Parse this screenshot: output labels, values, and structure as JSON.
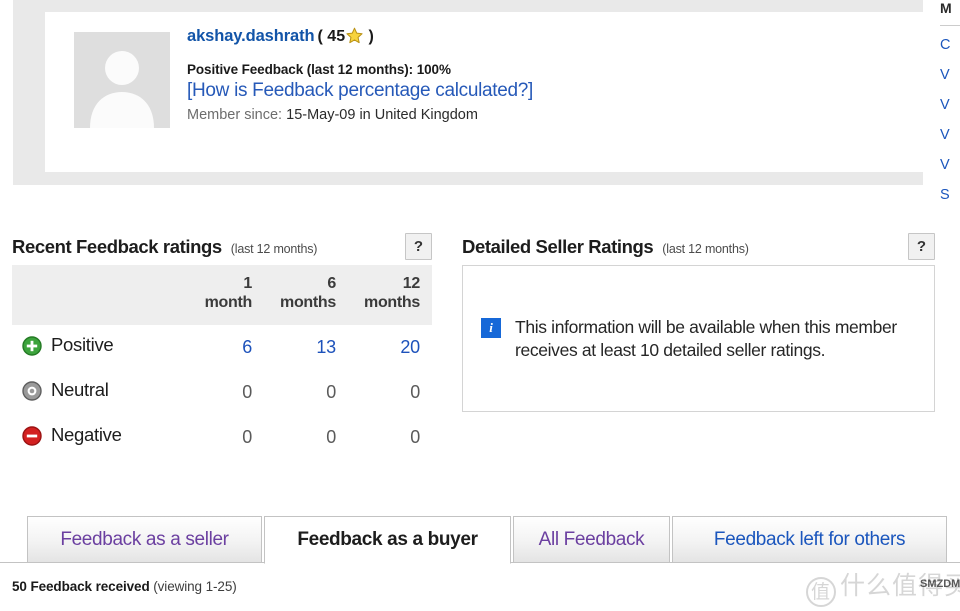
{
  "profile": {
    "username": "akshay.dashrath",
    "score_open": "(",
    "score": "45",
    "score_close": ")",
    "star_icon": "yellow-star-icon",
    "avatar_icon": "default-avatar-icon",
    "positive_feedback": "Positive Feedback (last 12 months): 100%",
    "how_calculated_link": "[How is Feedback percentage calculated?]",
    "member_since_label": "Member since:",
    "member_since_value": "15-May-09 in United Kingdom"
  },
  "recent_feedback": {
    "title": "Recent Feedback ratings",
    "subtitle": "(last 12 months)",
    "help_label": "?",
    "columns": [
      "",
      "1 month",
      "6 months",
      "12 months"
    ],
    "column_lines": [
      [
        "1",
        "month"
      ],
      [
        "6",
        "months"
      ],
      [
        "12",
        "months"
      ]
    ],
    "rows": [
      {
        "label": "Positive",
        "icon": "positive-plus-icon",
        "values": [
          "6",
          "13",
          "20"
        ],
        "linked": true
      },
      {
        "label": "Neutral",
        "icon": "neutral-circle-icon",
        "values": [
          "0",
          "0",
          "0"
        ],
        "linked": false
      },
      {
        "label": "Negative",
        "icon": "negative-minus-icon",
        "values": [
          "0",
          "0",
          "0"
        ],
        "linked": false
      }
    ]
  },
  "detailed_seller_ratings": {
    "title": "Detailed Seller Ratings",
    "subtitle": "(last 12 months)",
    "help_label": "?",
    "info_icon": "info-icon",
    "info_glyph": "i",
    "message": "This information will be available when this member receives at least 10 detailed seller ratings."
  },
  "tabs": [
    {
      "label": "Feedback as a seller",
      "state": "visited"
    },
    {
      "label": "Feedback as a buyer",
      "state": "active"
    },
    {
      "label": "All Feedback",
      "state": "visited"
    },
    {
      "label": "Feedback left for others",
      "state": "unvisited"
    }
  ],
  "footer": {
    "count_text": "50 Feedback received",
    "viewing_text": "(viewing 1-25)"
  },
  "right_rail": {
    "title": "M",
    "links": [
      "C",
      "V",
      "V",
      "V",
      "V",
      "S"
    ]
  },
  "watermark": {
    "badge": "值",
    "text": "什么值得买",
    "sub": "SMZDM"
  },
  "colors": {
    "link_blue": "#1b56bd",
    "username_blue": "#1254a8",
    "visited_purple": "#6b3fa0",
    "positive_green": "#3ca33c",
    "negative_red": "#d32020",
    "neutral_grey": "#8a8a8a",
    "star_yellow": "#f5cc28",
    "info_blue": "#1668d8",
    "band_grey": "#e9e9e9",
    "header_grey": "#eeeeee"
  }
}
